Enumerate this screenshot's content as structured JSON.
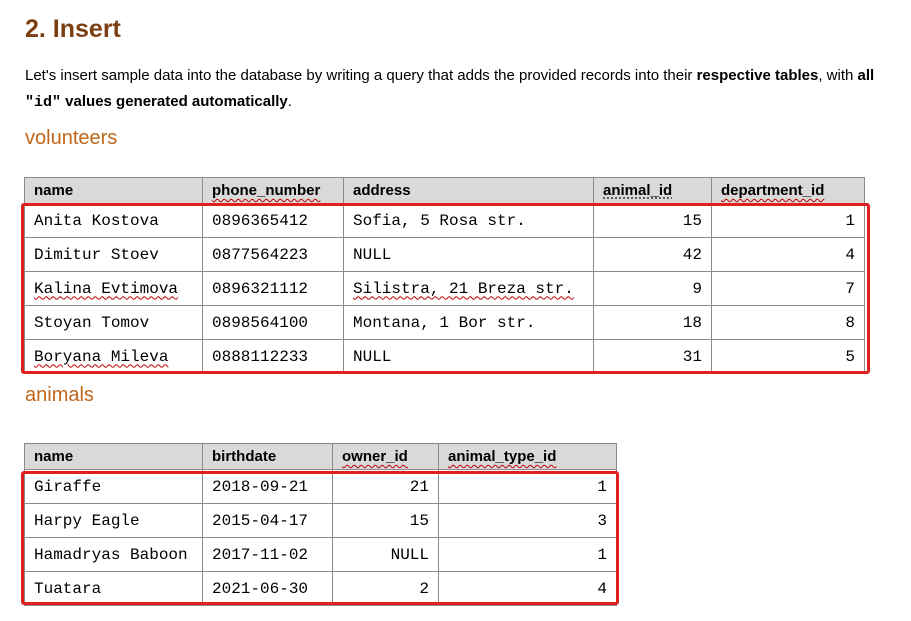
{
  "heading": "2. Insert",
  "intro": {
    "part1": "Let's insert sample data into the database by writing a query that adds the provided records into their ",
    "bold1": "respective tables",
    "part2": ", with ",
    "bold2a": "all ",
    "code": "\"id\"",
    "bold2b": " values generated automatically",
    "part3": "."
  },
  "volunteers": {
    "title": "volunteers",
    "columns": [
      "name",
      "phone_number",
      "address",
      "animal_id",
      "department_id"
    ],
    "rows": [
      [
        "Anita Kostova",
        "0896365412",
        "Sofia, 5 Rosa str.",
        "15",
        "1"
      ],
      [
        "Dimitur Stoev",
        "0877564223",
        "NULL",
        "42",
        "4"
      ],
      [
        "Kalina Evtimova",
        "0896321112",
        "Silistra, 21 Breza str.",
        "9",
        "7"
      ],
      [
        "Stoyan Tomov",
        "0898564100",
        "Montana, 1 Bor str.",
        "18",
        "8"
      ],
      [
        "Boryana Mileva",
        "0888112233",
        "NULL",
        "31",
        "5"
      ]
    ]
  },
  "animals": {
    "title": "animals",
    "columns": [
      "name",
      "birthdate",
      "owner_id",
      "animal_type_id"
    ],
    "rows": [
      [
        "Giraffe",
        "2018-09-21",
        "21",
        "1"
      ],
      [
        "Harpy Eagle",
        "2015-04-17",
        "15",
        "3"
      ],
      [
        "Hamadryas Baboon",
        "2017-11-02",
        "NULL",
        "1"
      ],
      [
        "Tuatara",
        "2021-06-30",
        "2",
        "4"
      ]
    ]
  },
  "colors": {
    "heading": "#7b3f12",
    "section_label": "#c0661a",
    "header_bg": "#d9d9d9",
    "highlight": "#e02020"
  }
}
